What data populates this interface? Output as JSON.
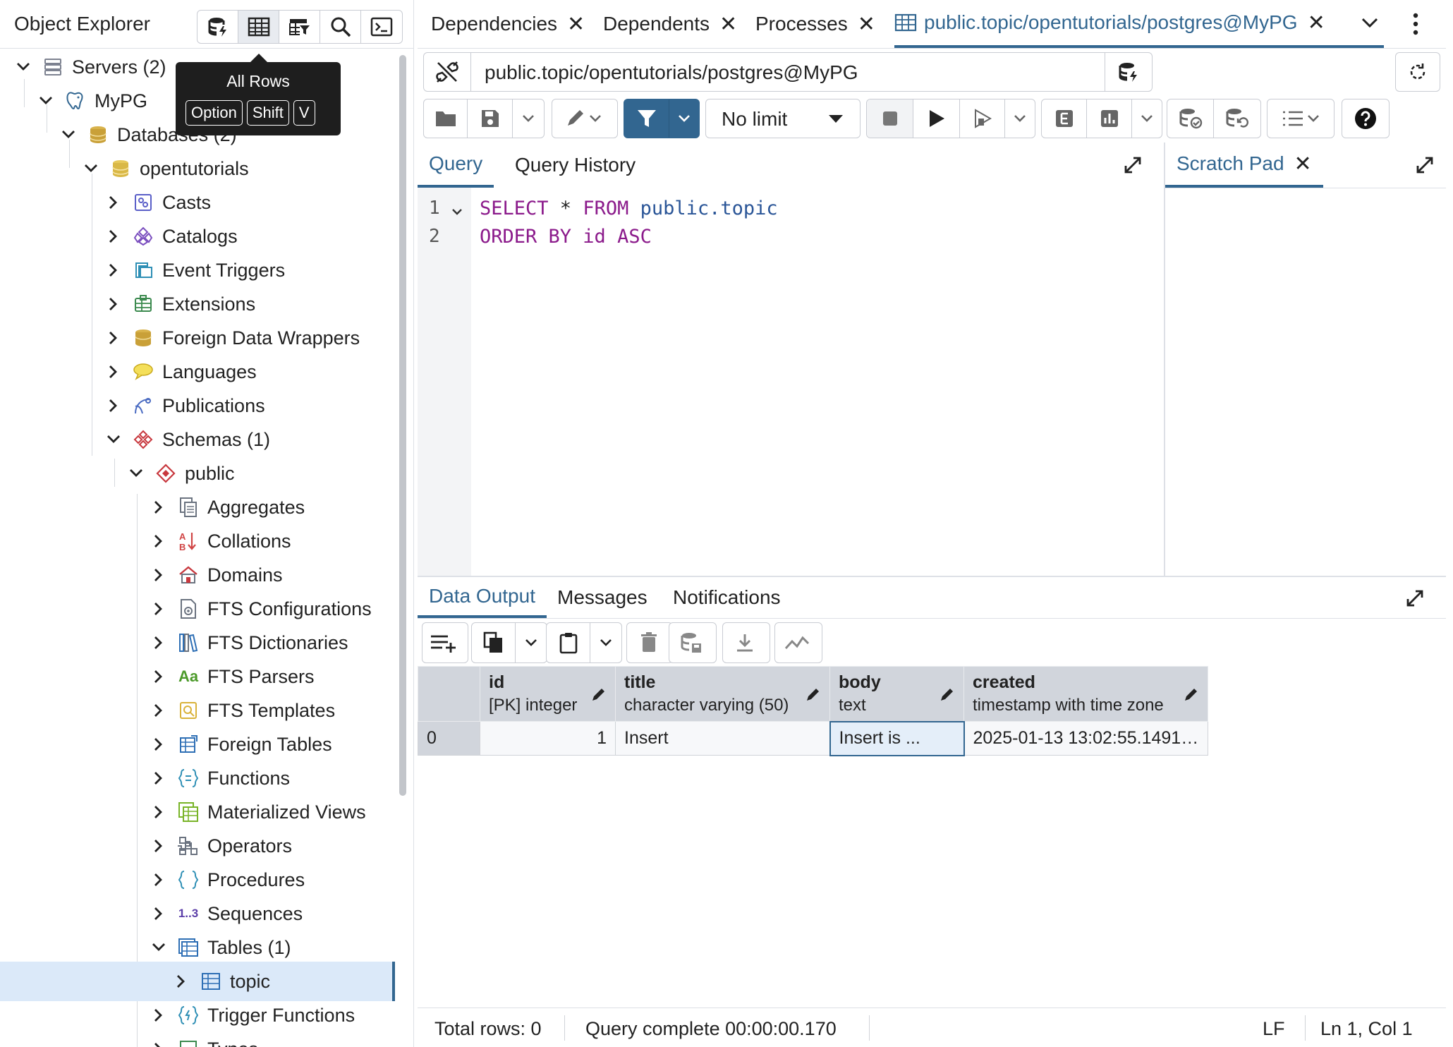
{
  "object_explorer": {
    "title": "Object Explorer",
    "tooltip": {
      "title": "All Rows",
      "keys": [
        "Option",
        "Shift",
        "V"
      ]
    },
    "tree": [
      {
        "label": "Servers (2)",
        "icon": "servers-icon"
      },
      {
        "label": "MyPG",
        "icon": "postgres-elephant-icon"
      },
      {
        "label": "Databases (2)",
        "icon": "databases-icon"
      },
      {
        "label": "opentutorials",
        "icon": "database-icon"
      },
      {
        "label": "Casts",
        "icon": "casts-icon"
      },
      {
        "label": "Catalogs",
        "icon": "catalogs-icon"
      },
      {
        "label": "Event Triggers",
        "icon": "event-triggers-icon"
      },
      {
        "label": "Extensions",
        "icon": "extensions-icon"
      },
      {
        "label": "Foreign Data Wrappers",
        "icon": "fdw-icon"
      },
      {
        "label": "Languages",
        "icon": "languages-icon"
      },
      {
        "label": "Publications",
        "icon": "publications-icon"
      },
      {
        "label": "Schemas (1)",
        "icon": "schemas-icon"
      },
      {
        "label": "public",
        "icon": "schema-icon"
      },
      {
        "label": "Aggregates",
        "icon": "aggregates-icon"
      },
      {
        "label": "Collations",
        "icon": "collations-icon"
      },
      {
        "label": "Domains",
        "icon": "domains-icon"
      },
      {
        "label": "FTS Configurations",
        "icon": "fts-config-icon"
      },
      {
        "label": "FTS Dictionaries",
        "icon": "fts-dict-icon"
      },
      {
        "label": "FTS Parsers",
        "icon": "fts-parsers-icon"
      },
      {
        "label": "FTS Templates",
        "icon": "fts-templates-icon"
      },
      {
        "label": "Foreign Tables",
        "icon": "foreign-tables-icon"
      },
      {
        "label": "Functions",
        "icon": "functions-icon"
      },
      {
        "label": "Materialized Views",
        "icon": "mat-views-icon"
      },
      {
        "label": "Operators",
        "icon": "operators-icon"
      },
      {
        "label": "Procedures",
        "icon": "procedures-icon"
      },
      {
        "label": "Sequences",
        "icon": "sequences-icon"
      },
      {
        "label": "Tables (1)",
        "icon": "tables-icon"
      },
      {
        "label": "topic",
        "icon": "table-icon"
      },
      {
        "label": "Trigger Functions",
        "icon": "trigger-functions-icon"
      },
      {
        "label": "Types",
        "icon": "types-icon"
      }
    ],
    "fts_parsers_glyph": "Aa",
    "sequences_glyph": "1..3"
  },
  "tabs": [
    {
      "label": "Dependencies",
      "close": "✕"
    },
    {
      "label": "Dependents",
      "close": "✕"
    },
    {
      "label": "Processes",
      "close": "✕"
    },
    {
      "label": "public.topic/opentutorials/postgres@MyPG",
      "close": "✕"
    }
  ],
  "connection": {
    "value": "public.topic/opentutorials/postgres@MyPG"
  },
  "toolbar": {
    "limit": "No limit"
  },
  "query_tabs": {
    "query": "Query",
    "history": "Query History",
    "scratch": "Scratch Pad",
    "scratch_close": "✕"
  },
  "editor": {
    "line_numbers": [
      "1",
      "2"
    ],
    "line1": {
      "k1": "SELECT",
      "star": " * ",
      "k2": "FROM",
      "tbl": " public.topic"
    },
    "line2": {
      "k1": "ORDER BY",
      "col": " id ",
      "k2": "ASC"
    }
  },
  "output_tabs": {
    "data": "Data Output",
    "messages": "Messages",
    "notifications": "Notifications"
  },
  "grid": {
    "columns": [
      {
        "name": "id",
        "type": "[PK] integer"
      },
      {
        "name": "title",
        "type": "character varying (50)"
      },
      {
        "name": "body",
        "type": "text"
      },
      {
        "name": "created",
        "type": "timestamp with time zone"
      }
    ],
    "rows": [
      {
        "index": "0",
        "id": "1",
        "title": "Insert",
        "body": "Insert is ...",
        "created": "2025-01-13 13:02:55.1491…"
      }
    ]
  },
  "status": {
    "total_rows": "Total rows: 0",
    "query_complete": "Query complete 00:00:00.170",
    "line_ending": "LF",
    "cursor": "Ln 1, Col 1"
  },
  "colors": {
    "accent": "#326690",
    "keyword": "#8b1a8b",
    "identifier": "#2a5597",
    "selection": "#dbe9f9"
  }
}
